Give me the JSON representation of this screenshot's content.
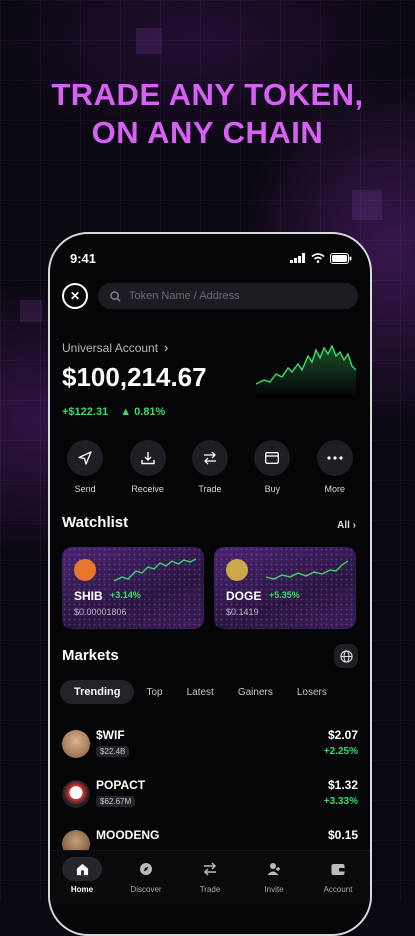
{
  "headline": {
    "line1": "TRADE ANY TOKEN,",
    "line2": "ON ANY CHAIN"
  },
  "status": {
    "time": "9:41"
  },
  "search": {
    "placeholder": "Token Name / Address"
  },
  "account": {
    "label": "Universal Account",
    "balance": "$100,214.67",
    "change_usd": "+$122.31",
    "change_pct": "0.81%"
  },
  "actions": [
    {
      "label": "Send",
      "icon": "send-icon"
    },
    {
      "label": "Receive",
      "icon": "download-icon"
    },
    {
      "label": "Trade",
      "icon": "swap-icon"
    },
    {
      "label": "Buy",
      "icon": "card-icon"
    },
    {
      "label": "More",
      "icon": "more-icon"
    }
  ],
  "watchlist": {
    "title": "Watchlist",
    "all_label": "All",
    "items": [
      {
        "symbol": "SHIB",
        "change": "+3.14%",
        "price": "$0.00001806"
      },
      {
        "symbol": "DOGE",
        "change": "+5.35%",
        "price": "$0.1419"
      }
    ]
  },
  "markets": {
    "title": "Markets",
    "tabs": [
      "Trending",
      "Top",
      "Latest",
      "Gainers",
      "Losers"
    ],
    "rows": [
      {
        "name": "$WIF",
        "cap": "$22.4B",
        "price": "$2.07",
        "change": "+2.25%"
      },
      {
        "name": "POPACT",
        "cap": "$62.67M",
        "price": "$1.32",
        "change": "+3.33%"
      },
      {
        "name": "MOODENG",
        "cap": "",
        "price": "$0.15",
        "change": ""
      }
    ]
  },
  "nav": [
    {
      "label": "Home",
      "icon": "home-icon"
    },
    {
      "label": "Discover",
      "icon": "compass-icon"
    },
    {
      "label": "Trade",
      "icon": "swap-icon"
    },
    {
      "label": "Invite",
      "icon": "user-icon"
    },
    {
      "label": "Account",
      "icon": "wallet-icon"
    }
  ],
  "colors": {
    "accent": "#d760f5",
    "positive": "#3ddc6a"
  }
}
